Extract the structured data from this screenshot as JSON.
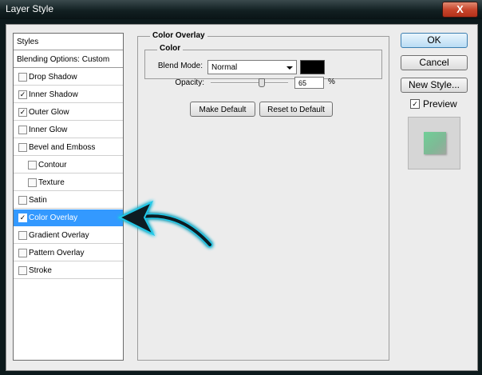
{
  "window": {
    "title": "Layer Style",
    "close_glyph": "X"
  },
  "styles": {
    "header": "Styles",
    "blending": "Blending Options: Custom",
    "items": [
      {
        "label": "Drop Shadow",
        "checked": false,
        "indent": false
      },
      {
        "label": "Inner Shadow",
        "checked": true,
        "indent": false
      },
      {
        "label": "Outer Glow",
        "checked": true,
        "indent": false
      },
      {
        "label": "Inner Glow",
        "checked": false,
        "indent": false
      },
      {
        "label": "Bevel and Emboss",
        "checked": false,
        "indent": false
      },
      {
        "label": "Contour",
        "checked": false,
        "indent": true
      },
      {
        "label": "Texture",
        "checked": false,
        "indent": true
      },
      {
        "label": "Satin",
        "checked": false,
        "indent": false
      },
      {
        "label": "Color Overlay",
        "checked": true,
        "indent": false,
        "selected": true
      },
      {
        "label": "Gradient Overlay",
        "checked": false,
        "indent": false
      },
      {
        "label": "Pattern Overlay",
        "checked": false,
        "indent": false
      },
      {
        "label": "Stroke",
        "checked": false,
        "indent": false
      }
    ]
  },
  "overlay": {
    "group_title": "Color Overlay",
    "color_title": "Color",
    "blend_mode_label": "Blend Mode:",
    "blend_mode_value": "Normal",
    "overlay_color": "#000000",
    "opacity_label": "Opacity:",
    "opacity_value": "65",
    "opacity_unit": "%",
    "make_default": "Make Default",
    "reset_default": "Reset to Default"
  },
  "actions": {
    "ok": "OK",
    "cancel": "Cancel",
    "new_style": "New Style...",
    "preview_label": "Preview",
    "preview_checked": true
  },
  "colors": {
    "selection": "#3399ff",
    "preview_fill": "#7fc59a",
    "arrow_glow": "#22c8e8"
  },
  "check_glyph": "✓"
}
